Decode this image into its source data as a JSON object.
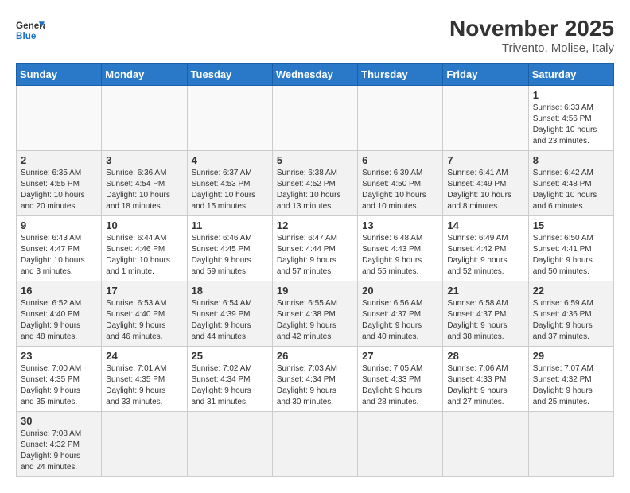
{
  "header": {
    "logo_general": "General",
    "logo_blue": "Blue",
    "month_year": "November 2025",
    "location": "Trivento, Molise, Italy"
  },
  "weekdays": [
    "Sunday",
    "Monday",
    "Tuesday",
    "Wednesday",
    "Thursday",
    "Friday",
    "Saturday"
  ],
  "weeks": [
    [
      {
        "day": "",
        "info": ""
      },
      {
        "day": "",
        "info": ""
      },
      {
        "day": "",
        "info": ""
      },
      {
        "day": "",
        "info": ""
      },
      {
        "day": "",
        "info": ""
      },
      {
        "day": "",
        "info": ""
      },
      {
        "day": "1",
        "info": "Sunrise: 6:33 AM\nSunset: 4:56 PM\nDaylight: 10 hours\nand 23 minutes."
      }
    ],
    [
      {
        "day": "2",
        "info": "Sunrise: 6:35 AM\nSunset: 4:55 PM\nDaylight: 10 hours\nand 20 minutes."
      },
      {
        "day": "3",
        "info": "Sunrise: 6:36 AM\nSunset: 4:54 PM\nDaylight: 10 hours\nand 18 minutes."
      },
      {
        "day": "4",
        "info": "Sunrise: 6:37 AM\nSunset: 4:53 PM\nDaylight: 10 hours\nand 15 minutes."
      },
      {
        "day": "5",
        "info": "Sunrise: 6:38 AM\nSunset: 4:52 PM\nDaylight: 10 hours\nand 13 minutes."
      },
      {
        "day": "6",
        "info": "Sunrise: 6:39 AM\nSunset: 4:50 PM\nDaylight: 10 hours\nand 10 minutes."
      },
      {
        "day": "7",
        "info": "Sunrise: 6:41 AM\nSunset: 4:49 PM\nDaylight: 10 hours\nand 8 minutes."
      },
      {
        "day": "8",
        "info": "Sunrise: 6:42 AM\nSunset: 4:48 PM\nDaylight: 10 hours\nand 6 minutes."
      }
    ],
    [
      {
        "day": "9",
        "info": "Sunrise: 6:43 AM\nSunset: 4:47 PM\nDaylight: 10 hours\nand 3 minutes."
      },
      {
        "day": "10",
        "info": "Sunrise: 6:44 AM\nSunset: 4:46 PM\nDaylight: 10 hours\nand 1 minute."
      },
      {
        "day": "11",
        "info": "Sunrise: 6:46 AM\nSunset: 4:45 PM\nDaylight: 9 hours\nand 59 minutes."
      },
      {
        "day": "12",
        "info": "Sunrise: 6:47 AM\nSunset: 4:44 PM\nDaylight: 9 hours\nand 57 minutes."
      },
      {
        "day": "13",
        "info": "Sunrise: 6:48 AM\nSunset: 4:43 PM\nDaylight: 9 hours\nand 55 minutes."
      },
      {
        "day": "14",
        "info": "Sunrise: 6:49 AM\nSunset: 4:42 PM\nDaylight: 9 hours\nand 52 minutes."
      },
      {
        "day": "15",
        "info": "Sunrise: 6:50 AM\nSunset: 4:41 PM\nDaylight: 9 hours\nand 50 minutes."
      }
    ],
    [
      {
        "day": "16",
        "info": "Sunrise: 6:52 AM\nSunset: 4:40 PM\nDaylight: 9 hours\nand 48 minutes."
      },
      {
        "day": "17",
        "info": "Sunrise: 6:53 AM\nSunset: 4:40 PM\nDaylight: 9 hours\nand 46 minutes."
      },
      {
        "day": "18",
        "info": "Sunrise: 6:54 AM\nSunset: 4:39 PM\nDaylight: 9 hours\nand 44 minutes."
      },
      {
        "day": "19",
        "info": "Sunrise: 6:55 AM\nSunset: 4:38 PM\nDaylight: 9 hours\nand 42 minutes."
      },
      {
        "day": "20",
        "info": "Sunrise: 6:56 AM\nSunset: 4:37 PM\nDaylight: 9 hours\nand 40 minutes."
      },
      {
        "day": "21",
        "info": "Sunrise: 6:58 AM\nSunset: 4:37 PM\nDaylight: 9 hours\nand 38 minutes."
      },
      {
        "day": "22",
        "info": "Sunrise: 6:59 AM\nSunset: 4:36 PM\nDaylight: 9 hours\nand 37 minutes."
      }
    ],
    [
      {
        "day": "23",
        "info": "Sunrise: 7:00 AM\nSunset: 4:35 PM\nDaylight: 9 hours\nand 35 minutes."
      },
      {
        "day": "24",
        "info": "Sunrise: 7:01 AM\nSunset: 4:35 PM\nDaylight: 9 hours\nand 33 minutes."
      },
      {
        "day": "25",
        "info": "Sunrise: 7:02 AM\nSunset: 4:34 PM\nDaylight: 9 hours\nand 31 minutes."
      },
      {
        "day": "26",
        "info": "Sunrise: 7:03 AM\nSunset: 4:34 PM\nDaylight: 9 hours\nand 30 minutes."
      },
      {
        "day": "27",
        "info": "Sunrise: 7:05 AM\nSunset: 4:33 PM\nDaylight: 9 hours\nand 28 minutes."
      },
      {
        "day": "28",
        "info": "Sunrise: 7:06 AM\nSunset: 4:33 PM\nDaylight: 9 hours\nand 27 minutes."
      },
      {
        "day": "29",
        "info": "Sunrise: 7:07 AM\nSunset: 4:32 PM\nDaylight: 9 hours\nand 25 minutes."
      }
    ],
    [
      {
        "day": "30",
        "info": "Sunrise: 7:08 AM\nSunset: 4:32 PM\nDaylight: 9 hours\nand 24 minutes."
      },
      {
        "day": "",
        "info": ""
      },
      {
        "day": "",
        "info": ""
      },
      {
        "day": "",
        "info": ""
      },
      {
        "day": "",
        "info": ""
      },
      {
        "day": "",
        "info": ""
      },
      {
        "day": "",
        "info": ""
      }
    ]
  ]
}
